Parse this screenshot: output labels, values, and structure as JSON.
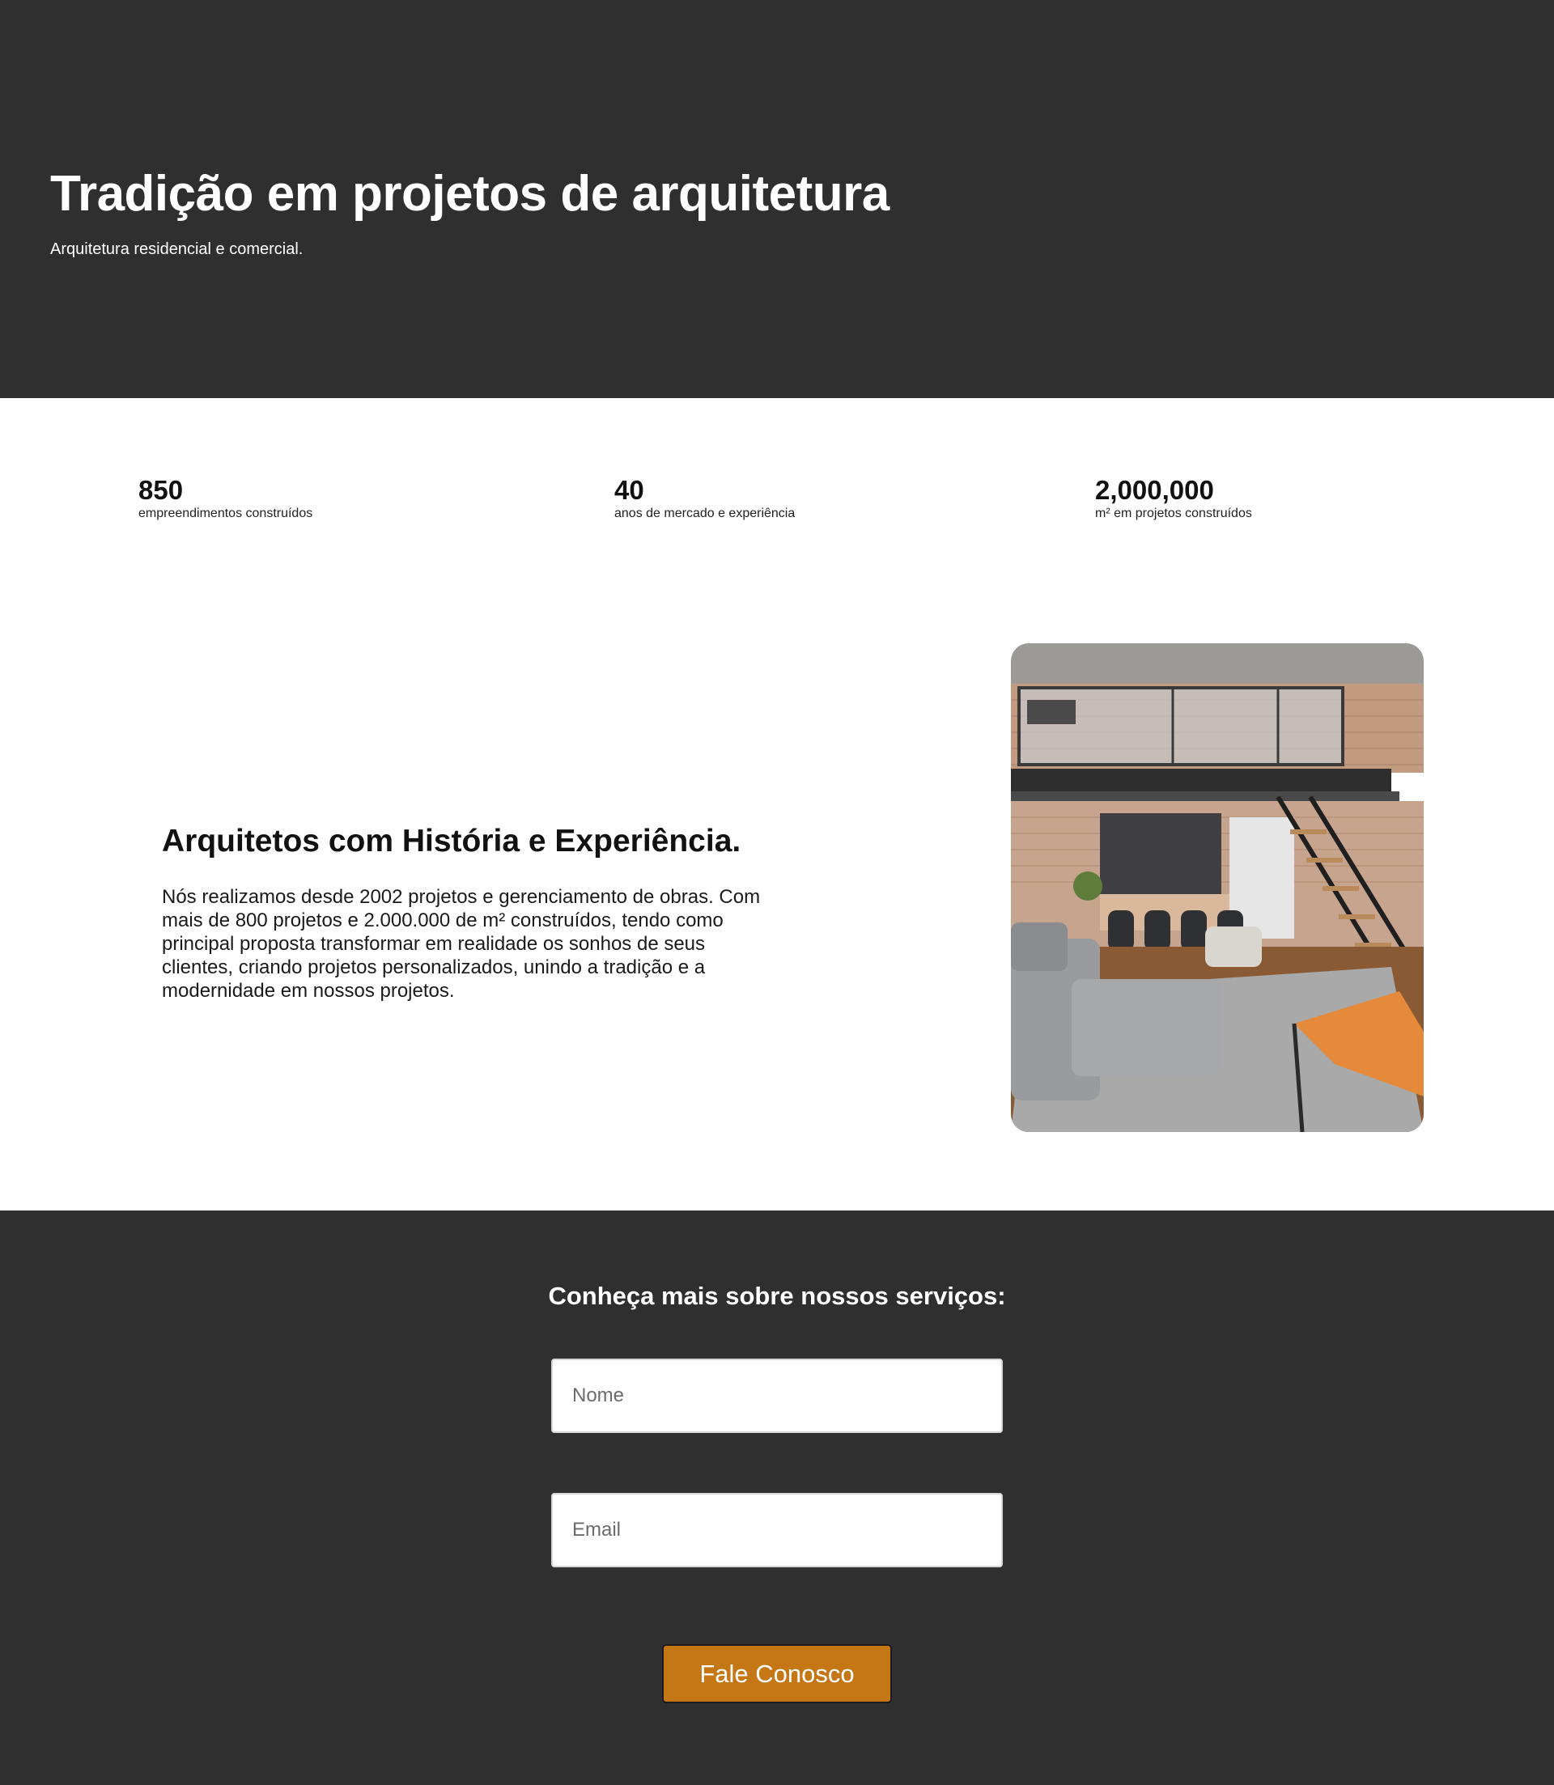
{
  "hero": {
    "title": "Tradição em projetos de arquitetura",
    "subtitle": "Arquitetura residencial e comercial."
  },
  "stats": [
    {
      "value": "850",
      "label": "empreendimentos construídos"
    },
    {
      "value": "40",
      "label": "anos de mercado e experiência"
    },
    {
      "value": "2,000,000",
      "label": "m² em projetos construídos"
    }
  ],
  "about": {
    "title": "Arquitetos com História e Experiência.",
    "text": "Nós realizamos desde 2002 projetos e gerenciamento de obras. Com mais de 800 projetos e 2.000.000 de m² construídos, tendo como principal proposta transformar em realidade os sonhos de seus clientes, criando projetos personalizados, unindo a tradição e a modernidade em nossos projetos."
  },
  "contact": {
    "title": "Conheça mais sobre nossos serviços:",
    "name_placeholder": "Nome",
    "email_placeholder": "Email",
    "submit_label": "Fale Conosco"
  },
  "colors": {
    "dark_background": "#2f2f2f",
    "accent": "#c47714",
    "text_dark": "#111111",
    "white": "#ffffff"
  }
}
